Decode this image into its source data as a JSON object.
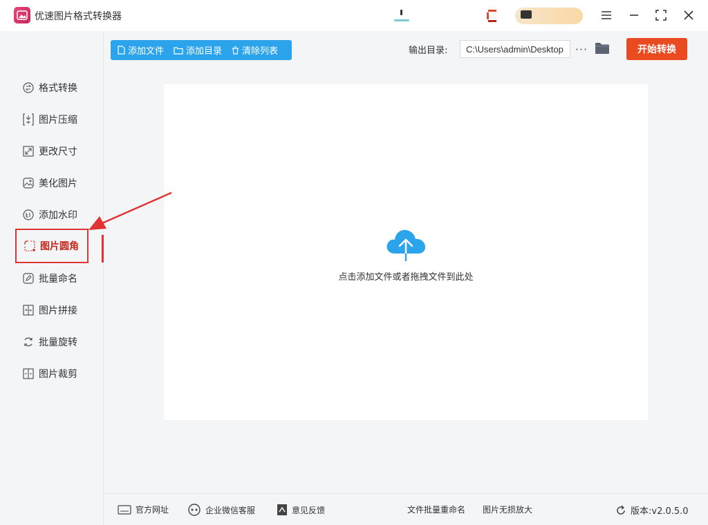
{
  "app": {
    "title": "优速图片格式转换器"
  },
  "sidebar": {
    "items": [
      {
        "label": "格式转换",
        "icon": "swap-icon"
      },
      {
        "label": "图片压缩",
        "icon": "compress-icon"
      },
      {
        "label": "更改尺寸",
        "icon": "resize-icon"
      },
      {
        "label": "美化图片",
        "icon": "beautify-icon"
      },
      {
        "label": "添加水印",
        "icon": "watermark-icon"
      },
      {
        "label": "图片圆角",
        "icon": "rounded-corner-icon",
        "active": true
      },
      {
        "label": "批量命名",
        "icon": "rename-icon"
      },
      {
        "label": "图片拼接",
        "icon": "stitch-icon"
      },
      {
        "label": "批量旋转",
        "icon": "rotate-icon"
      },
      {
        "label": "图片裁剪",
        "icon": "crop-icon"
      }
    ]
  },
  "toolbar": {
    "add_file": "添加文件",
    "add_folder": "添加目录",
    "clear_list": "清除列表",
    "output_label": "输出目录:",
    "output_path": "C:\\Users\\admin\\Desktop",
    "more": "···",
    "start": "开始转换"
  },
  "main": {
    "drop_hint": "点击添加文件或者拖拽文件到此处"
  },
  "footer": {
    "website": "官方网址",
    "wechat": "企业微信客服",
    "feedback": "意见反馈",
    "batch_rename": "文件批量重命名",
    "lossless_enlarge": "图片无损放大",
    "version": "版本:v2.0.5.0"
  },
  "colors": {
    "accent_blue": "#2ca4ec",
    "start_orange": "#ea4a1f",
    "highlight_red": "#e03333"
  }
}
